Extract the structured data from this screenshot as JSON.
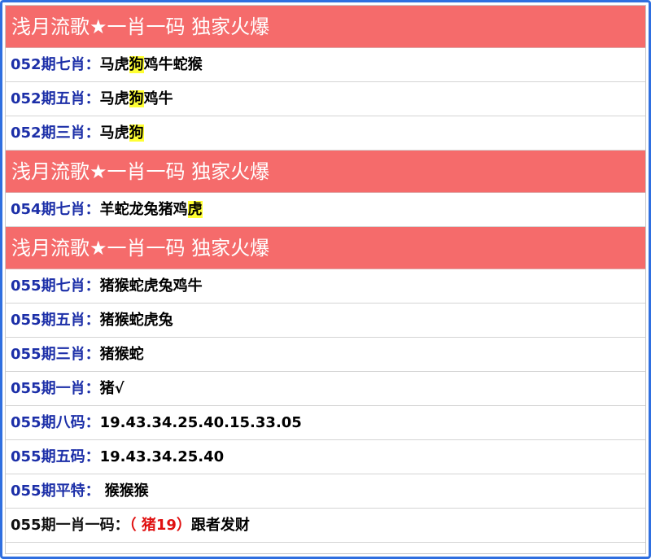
{
  "colors": {
    "header_bg": "#f56b6b",
    "label_blue": "#1c2fa8",
    "highlight": "#ffff33",
    "red_text": "#e01010",
    "frame_border": "#2f6fe0"
  },
  "sections": [
    {
      "header": "浅月流歌★一肖一码 独家火爆",
      "rows": [
        {
          "label": "052期七肖：",
          "pre": "马虎",
          "hl": "狗",
          "post": "鸡牛蛇猴"
        },
        {
          "label": "052期五肖：",
          "pre": "马虎",
          "hl": "狗",
          "post": "鸡牛"
        },
        {
          "label": "052期三肖：",
          "pre": "马虎",
          "hl": "狗",
          "post": ""
        }
      ]
    },
    {
      "header": "浅月流歌★一肖一码 独家火爆",
      "rows": [
        {
          "label": "054期七肖：",
          "pre": "羊蛇龙兔猪鸡",
          "hl": "虎",
          "post": ""
        }
      ]
    },
    {
      "header": "浅月流歌★一肖一码 独家火爆",
      "rows": [
        {
          "label": "055期七肖：",
          "pre": "猪猴蛇虎兔鸡牛",
          "hl": "",
          "post": ""
        },
        {
          "label": "055期五肖：",
          "pre": "猪猴蛇虎兔",
          "hl": "",
          "post": ""
        },
        {
          "label": "055期三肖：",
          "pre": "猪猴蛇",
          "hl": "",
          "post": ""
        },
        {
          "label": "055期一肖：",
          "pre": "猪√",
          "hl": "",
          "post": ""
        },
        {
          "label": "055期八码：",
          "pre": "19.43.34.25.40.15.33.05",
          "hl": "",
          "post": ""
        },
        {
          "label": "055期五码：",
          "pre": "19.43.34.25.40",
          "hl": "",
          "post": ""
        },
        {
          "label": "055期平特：",
          "pre": "猴猴猴",
          "hl": "",
          "post": ""
        }
      ],
      "final_row": {
        "label": "055期一肖一码：",
        "red": "（ 猪19）",
        "post": "跟者发财"
      }
    }
  ]
}
